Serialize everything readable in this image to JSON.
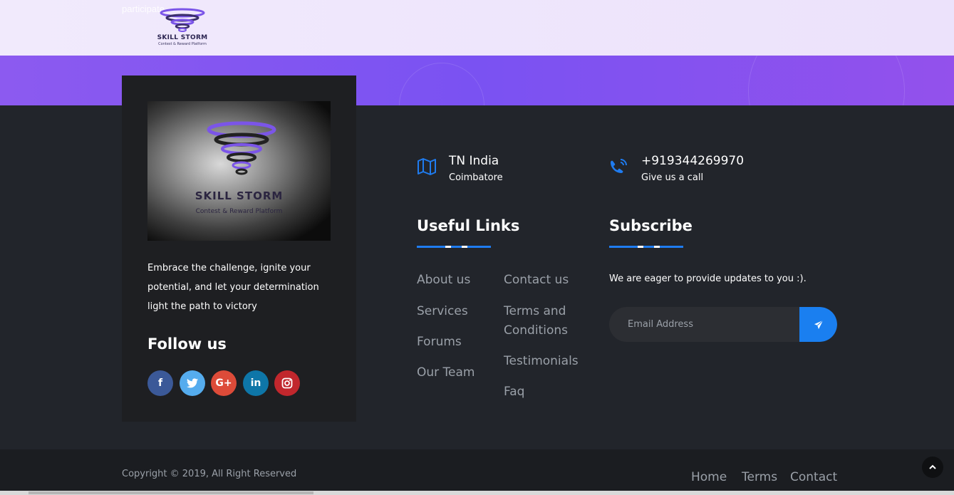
{
  "header": {
    "ghost_text": "participate",
    "logo": {
      "word": "SKILL STORM",
      "tagline": "Contest & Reward Platform"
    }
  },
  "card": {
    "image_logo": {
      "word": "SKILL STORM",
      "tagline": "Contest & Reward Platform"
    },
    "tagline": "Embrace the challenge, ignite your potential, and let your determination light the path to victory",
    "follow_title": "Follow us",
    "socials": [
      {
        "name": "facebook-icon",
        "glyph": "f",
        "color": "#3b5998"
      },
      {
        "name": "twitter-icon",
        "glyph": "🐦",
        "color": "#55acee"
      },
      {
        "name": "google-plus-icon",
        "glyph": "G+",
        "color": "#dd4b39"
      },
      {
        "name": "linkedin-icon",
        "glyph": "in",
        "color": "#0e76a8"
      },
      {
        "name": "instagram-icon",
        "glyph": "◎",
        "color": "#c1272d"
      }
    ]
  },
  "contact": {
    "location": {
      "title": "TN India",
      "sub": "Coimbatore",
      "icon": "map-icon"
    },
    "phone": {
      "title": "+919344269970",
      "sub": "Give us a call",
      "icon": "phone-icon"
    }
  },
  "useful_links": {
    "title": "Useful Links",
    "col1": [
      "About us",
      "Services",
      "Forums",
      "Our Team"
    ],
    "col2": [
      "Contact us",
      "Terms and Conditions",
      "Testimonials",
      "Faq"
    ]
  },
  "subscribe": {
    "title": "Subscribe",
    "text": "We are eager to provide updates to you :).",
    "placeholder": "Email Address",
    "icon": "send-icon"
  },
  "bottom": {
    "copyright": "Copyright © 2019, All Right Reserved",
    "nav": [
      "Home",
      "Terms",
      "Contact"
    ]
  },
  "colors": {
    "accent": "#1f7cf0",
    "band": "#7a52f2",
    "bg": "#22252b"
  }
}
